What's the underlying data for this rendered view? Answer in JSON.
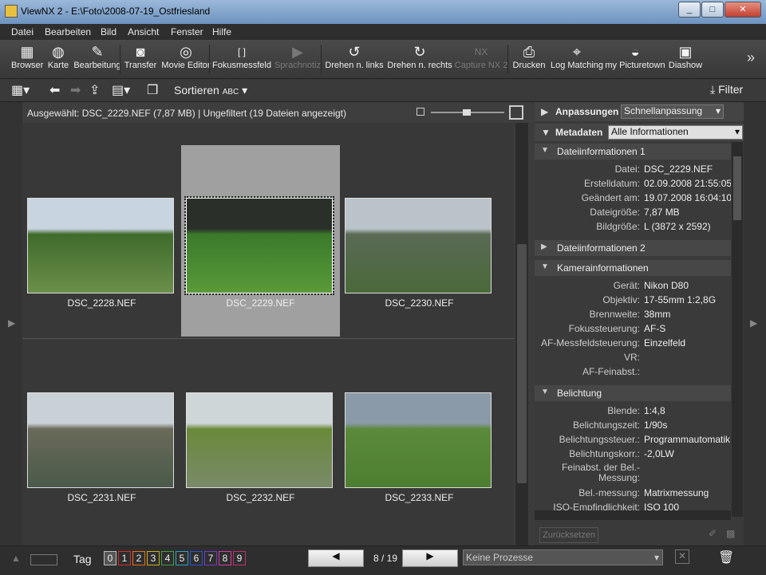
{
  "window": {
    "title": "ViewNX 2 - E:\\Foto\\2008-07-19_Ostfriesland"
  },
  "menu": [
    "Datei",
    "Bearbeiten",
    "Bild",
    "Ansicht",
    "Fenster",
    "Hilfe"
  ],
  "toolbar": [
    {
      "label": "Browser",
      "icon": "grid-icon",
      "glyph": "▦",
      "enabled": true
    },
    {
      "label": "Karte",
      "icon": "globe-icon",
      "glyph": "◍",
      "enabled": true
    },
    {
      "label": "Bearbeitung",
      "icon": "edit-icon",
      "glyph": "✎",
      "enabled": true
    },
    {
      "label": "Transfer",
      "icon": "camera-icon",
      "glyph": "◙",
      "enabled": true
    },
    {
      "label": "Movie Editor",
      "icon": "film-reel-icon",
      "glyph": "◎",
      "enabled": true
    },
    {
      "label": "Fokusmessfeld",
      "icon": "focus-brackets-icon",
      "glyph": "[ ]",
      "enabled": true
    },
    {
      "label": "Sprachnotiz",
      "icon": "play-note-icon",
      "glyph": "▶",
      "enabled": false
    },
    {
      "label": "Drehen n. links",
      "icon": "rotate-left-icon",
      "glyph": "↺",
      "enabled": true
    },
    {
      "label": "Drehen n. rechts",
      "icon": "rotate-right-icon",
      "glyph": "↻",
      "enabled": true
    },
    {
      "label": "Capture NX 2",
      "icon": "capture-nx-icon",
      "glyph": "NX",
      "enabled": false
    },
    {
      "label": "Drucken",
      "icon": "printer-icon",
      "glyph": "⎙",
      "enabled": true
    },
    {
      "label": "Log Matching",
      "icon": "log-matching-icon",
      "glyph": "⌖",
      "enabled": true
    },
    {
      "label": "my Picturetown",
      "icon": "picturetown-icon",
      "glyph": "◒",
      "enabled": true
    },
    {
      "label": "Diashow",
      "icon": "slideshow-icon",
      "glyph": "▣",
      "enabled": true
    }
  ],
  "toolbar2": {
    "sort_label": "Sortieren",
    "sort_glyph": "ABC",
    "filter_label": "Filter"
  },
  "status": {
    "text": "Ausgewählt: DSC_2229.NEF (7,87 MB) | Ungefiltert  (19 Dateien angezeigt)"
  },
  "thumbnails": [
    {
      "name": "DSC_2228.NEF",
      "selected": false,
      "colors": [
        "#c8d4e0",
        "#3f6b2c",
        "#6b8f4a"
      ]
    },
    {
      "name": "DSC_2229.NEF",
      "selected": true,
      "colors": [
        "#2a2f2a",
        "#3a7a2a",
        "#5a9a3a"
      ]
    },
    {
      "name": "DSC_2230.NEF",
      "selected": false,
      "colors": [
        "#b9c3c9",
        "#5a6a55",
        "#4a6a3a"
      ]
    },
    {
      "name": "DSC_2231.NEF",
      "selected": false,
      "colors": [
        "#c9d1d6",
        "#6a6a5a",
        "#4a5a4a"
      ]
    },
    {
      "name": "DSC_2232.NEF",
      "selected": false,
      "colors": [
        "#cfd6d8",
        "#6a8a3a",
        "#7a8a6a"
      ]
    },
    {
      "name": "DSC_2233.NEF",
      "selected": false,
      "colors": [
        "#8a9aa8",
        "#5a8a3a",
        "#4e7e30"
      ]
    }
  ],
  "right_panel": {
    "adjust_label": "Anpassungen",
    "adjust_select": "Schnellanpassung",
    "meta_label": "Metadaten",
    "meta_select": "Alle Informationen",
    "sections": [
      {
        "title": "Dateiinformationen 1",
        "expanded": true,
        "rows": [
          {
            "k": "Datei:",
            "v": "DSC_2229.NEF"
          },
          {
            "k": "Erstelldatum:",
            "v": "02.09.2008 21:55:05"
          },
          {
            "k": "Geändert am:",
            "v": "19.07.2008 16:04:10"
          },
          {
            "k": "Dateigröße:",
            "v": "7,87 MB"
          },
          {
            "k": "Bildgröße:",
            "v": "L (3872 x 2592)"
          }
        ]
      },
      {
        "title": "Dateiinformationen 2",
        "expanded": false,
        "rows": []
      },
      {
        "title": "Kamerainformationen",
        "expanded": true,
        "rows": [
          {
            "k": "Gerät:",
            "v": "Nikon D80"
          },
          {
            "k": "Objektiv:",
            "v": "17-55mm 1:2,8G"
          },
          {
            "k": "Brennweite:",
            "v": "38mm"
          },
          {
            "k": "Fokussteuerung:",
            "v": "AF-S"
          },
          {
            "k": "AF-Messfeldsteuerung:",
            "v": "Einzelfeld"
          },
          {
            "k": "VR:",
            "v": ""
          },
          {
            "k": "AF-Feinabst.:",
            "v": ""
          }
        ]
      },
      {
        "title": "Belichtung",
        "expanded": true,
        "rows": [
          {
            "k": "Blende:",
            "v": "1:4,8"
          },
          {
            "k": "Belichtungszeit:",
            "v": "1/90s"
          },
          {
            "k": "Belichtungssteuer.:",
            "v": "Programmautomatik"
          },
          {
            "k": "Belichtungskorr.:",
            "v": "-2,0LW"
          },
          {
            "k": "Feinabst. der Bel.-Messung:",
            "v": ""
          },
          {
            "k": "Bel.-messung:",
            "v": "Matrixmessung"
          },
          {
            "k": "ISO-Empfindlichkeit:",
            "v": "ISO 100"
          }
        ]
      }
    ],
    "reset_label": "Zurücksetzen"
  },
  "bottom": {
    "tag_label": "Tag",
    "tags": [
      {
        "n": "0",
        "color": "#bbbbbb"
      },
      {
        "n": "1",
        "color": "#d03030"
      },
      {
        "n": "2",
        "color": "#e07020"
      },
      {
        "n": "3",
        "color": "#c8b020"
      },
      {
        "n": "4",
        "color": "#40a040"
      },
      {
        "n": "5",
        "color": "#30a0c0"
      },
      {
        "n": "6",
        "color": "#3050d0"
      },
      {
        "n": "7",
        "color": "#7040c0"
      },
      {
        "n": "8",
        "color": "#d040a0"
      },
      {
        "n": "9",
        "color": "#c03070"
      }
    ],
    "page": "8 / 19",
    "process_select": "Keine Prozesse"
  }
}
